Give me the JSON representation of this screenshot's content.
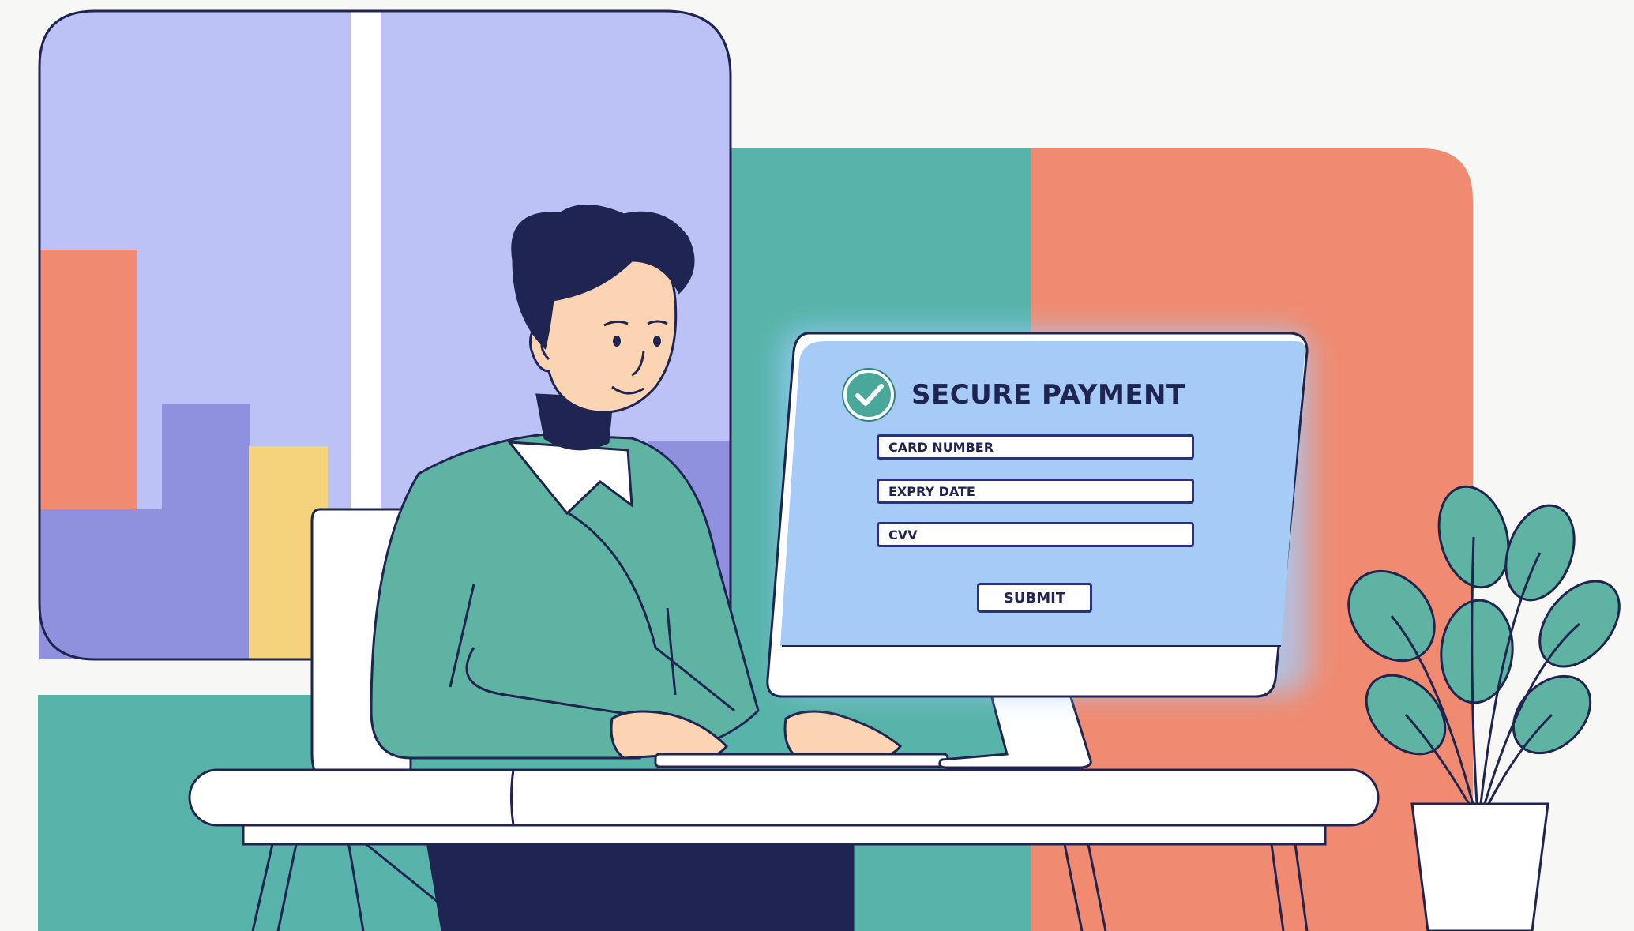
{
  "payment_form": {
    "title": "SECURE PAYMENT",
    "icon": "check-circle-icon",
    "card_number_placeholder": "CARD NUMBER",
    "expiry_date_placeholder": "EXPRY DATE",
    "cvv_placeholder": "CVV",
    "submit_label": "SUBMIT"
  },
  "colors": {
    "window_sky": "#bcc2f5",
    "teal": "#58b3aa",
    "coral": "#f08a70",
    "periwinkle": "#8f91df",
    "yellow": "#f5d27c",
    "navy": "#1f2450",
    "sweater": "#5fb3a2",
    "screen": "#a6cbf6",
    "skin": "#fbd4b4"
  }
}
